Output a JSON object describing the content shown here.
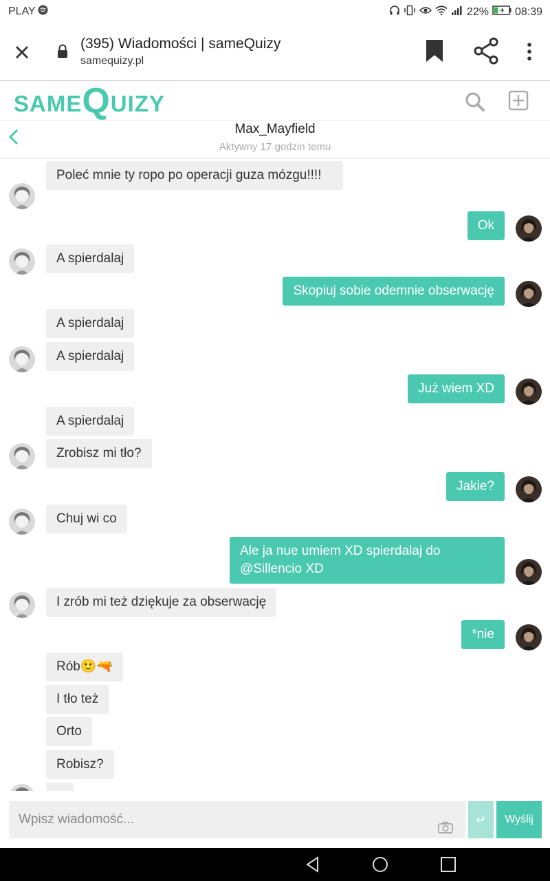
{
  "status_bar": {
    "carrier": "PLAY",
    "battery": "22%",
    "time": "08:39"
  },
  "browser": {
    "title": "(395) Wiadomości | sameQuizy",
    "url": "samequizy.pl"
  },
  "site": {
    "logo_same": "SAME",
    "logo_q": "Q",
    "logo_uizy": "UIZY",
    "brand_color": "#4ac9b0"
  },
  "conversation": {
    "name": "Max_Mayfield",
    "status": "Aktywny 17 godzin temu"
  },
  "messages": [
    {
      "side": "in",
      "text": "Poleć mnie ty ropo po operacji guza mózgu!!!!",
      "avatar": true
    },
    {
      "side": "out",
      "text": "Ok",
      "avatar": true
    },
    {
      "side": "in",
      "text": "A spierdalaj",
      "avatar": true
    },
    {
      "side": "out",
      "text": "Skopiuj sobie odemnie obserwację",
      "avatar": true
    },
    {
      "side": "in",
      "text": "A spierdalaj",
      "avatar": false
    },
    {
      "side": "in",
      "text": "A spierdalaj",
      "avatar": true
    },
    {
      "side": "out",
      "text": "Już wiem XD",
      "avatar": true
    },
    {
      "side": "in",
      "text": "A spierdalaj",
      "avatar": false
    },
    {
      "side": "in",
      "text": "Zrobisz mi tło?",
      "avatar": true
    },
    {
      "side": "out",
      "text": "Jakie?",
      "avatar": true
    },
    {
      "side": "in",
      "text": "Chuj wi co",
      "avatar": true
    },
    {
      "side": "out",
      "text": "Ale ja nue umiem XD spierdalaj do @Sillencio XD",
      "avatar": true
    },
    {
      "side": "in",
      "text": "I zrób mi też dziękuje za obserwację",
      "avatar": true
    },
    {
      "side": "out",
      "text": "*nie",
      "avatar": true
    },
    {
      "side": "in",
      "text": "Rób🙂🔫",
      "avatar": false
    },
    {
      "side": "in",
      "text": "I tło też",
      "avatar": false
    },
    {
      "side": "in",
      "text": "Orto",
      "avatar": false
    },
    {
      "side": "in",
      "text": "Robisz?",
      "avatar": false
    }
  ],
  "composer": {
    "placeholder": "Wpisz wiadomość...",
    "send_label": "Wyślij",
    "enter_icon": "↵"
  },
  "icons": {
    "close": "close-icon",
    "lock": "lock-icon",
    "bookmark": "bookmark-icon",
    "share": "share-icon",
    "more": "more-vertical-icon",
    "search": "search-icon",
    "add": "add-square-icon",
    "back": "chevron-left-icon",
    "camera": "camera-icon"
  }
}
